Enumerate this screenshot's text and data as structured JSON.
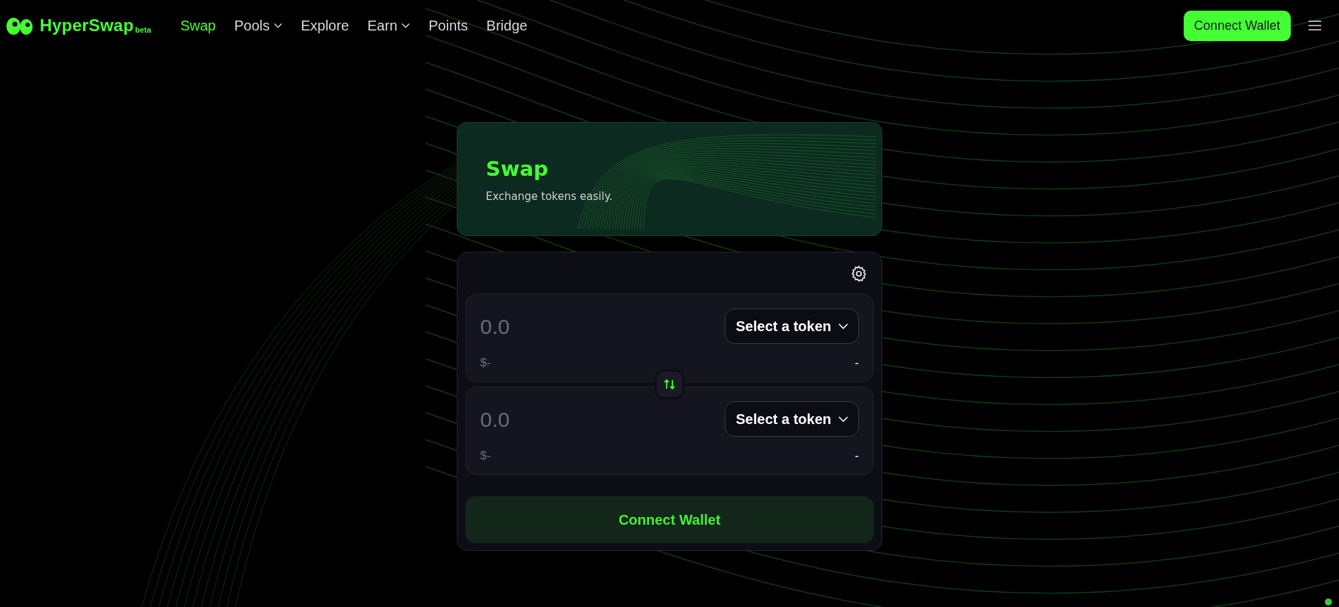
{
  "brand": {
    "name": "HyperSwap",
    "tag": "beta"
  },
  "nav": [
    {
      "label": "Swap",
      "selected": true,
      "dropdown": false
    },
    {
      "label": "Pools",
      "selected": false,
      "dropdown": true
    },
    {
      "label": "Explore",
      "selected": false,
      "dropdown": false
    },
    {
      "label": "Earn",
      "selected": false,
      "dropdown": true
    },
    {
      "label": "Points",
      "selected": false,
      "dropdown": false
    },
    {
      "label": "Bridge",
      "selected": false,
      "dropdown": false
    }
  ],
  "header_button": "Connect Wallet",
  "hero": {
    "title": "Swap",
    "subtitle": "Exchange tokens easily."
  },
  "swap": {
    "inputs": [
      {
        "placeholder": "0.0",
        "token_button": "Select a token",
        "usd": "$-",
        "balance": "-"
      },
      {
        "placeholder": "0.0",
        "token_button": "Select a token",
        "usd": "$-",
        "balance": "-"
      }
    ],
    "action_button": "Connect Wallet"
  }
}
